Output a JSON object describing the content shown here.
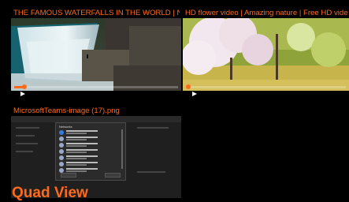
{
  "tiles": [
    {
      "title": "THE FAMOUS WATERFALLS IN THE WORLD | NIAGARA FALLS",
      "progress": 0.06
    },
    {
      "title": "HD flower video | Amazing nature | Free HD video",
      "progress": 0.0
    },
    {
      "title": "MicrosoftTeams-image (17).png"
    }
  ],
  "dialog": {
    "title": "Networks"
  },
  "overlay_label": "Quad View",
  "colors": {
    "accent": "#ff6a1a",
    "background": "#000000"
  },
  "icons": {
    "play": "play-icon"
  }
}
